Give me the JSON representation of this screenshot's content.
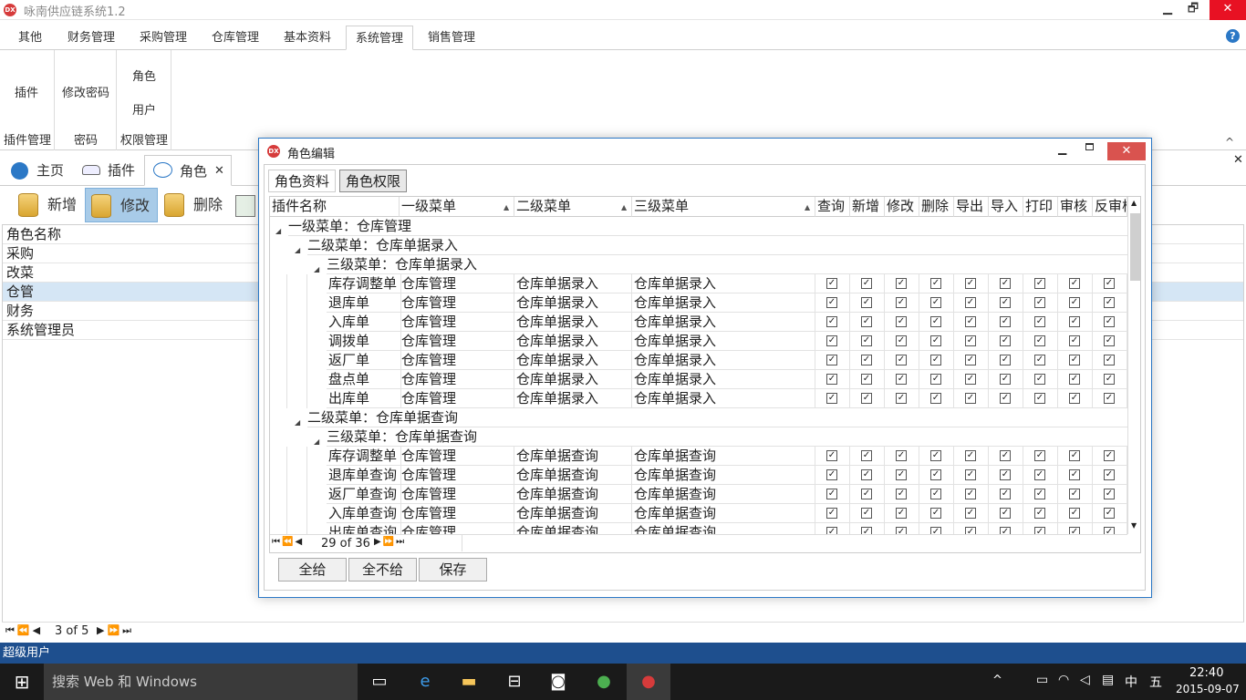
{
  "app": {
    "title": "咏南供应链系统1.2",
    "logo_text": "DX",
    "min": "▁",
    "restore": "🗗",
    "close": "✕"
  },
  "ribbon": {
    "tabs": [
      "其他",
      "财务管理",
      "采购管理",
      "仓库管理",
      "基本资料",
      "系统管理",
      "销售管理"
    ],
    "active_tab": "系统管理",
    "groups": [
      {
        "buttons": [
          "插件"
        ],
        "label": "插件管理"
      },
      {
        "buttons": [
          "修改密码"
        ],
        "label": "密码"
      },
      {
        "buttons": [
          "角色",
          "用户"
        ],
        "label": "权限管理"
      }
    ],
    "help_icon": "?",
    "collapse_icon": "^"
  },
  "doctabs": {
    "home": "主页",
    "plugin": "插件",
    "role": "角色",
    "close": "✕"
  },
  "toolbar": {
    "add": "新增",
    "edit": "修改",
    "delete": "删除"
  },
  "rolelist": {
    "header": "角色名称",
    "rows": [
      "采购",
      "改菜",
      "仓管",
      "财务",
      "系统管理员"
    ],
    "selected": "仓管",
    "pager": "3 of 5"
  },
  "status": {
    "user": "超级用户"
  },
  "taskbar": {
    "search_placeholder": "搜索 Web 和 Windows",
    "time": "22:40",
    "date": "2015-09-07",
    "ime": "中",
    "ime2": "五"
  },
  "dialog": {
    "title": "角色编辑",
    "tabs": [
      "角色资料",
      "角色权限"
    ],
    "active_tab": "角色权限",
    "columns": [
      "插件名称",
      "一级菜单",
      "二级菜单",
      "三级菜单",
      "查询",
      "新增",
      "修改",
      "删除",
      "导出",
      "导入",
      "打印",
      "审核",
      "反审核"
    ],
    "groups": [
      {
        "label": "一级菜单：仓库管理",
        "level": 1,
        "expand": "◢"
      },
      {
        "label": "二级菜单：仓库单据录入",
        "level": 2,
        "expand": "◢"
      },
      {
        "label": "三级菜单：仓库单据录入",
        "level": 3,
        "expand": "◢"
      }
    ],
    "rows_a": [
      [
        "库存调整单",
        "仓库管理",
        "仓库单据录入",
        "仓库单据录入"
      ],
      [
        "退库单",
        "仓库管理",
        "仓库单据录入",
        "仓库单据录入"
      ],
      [
        "入库单",
        "仓库管理",
        "仓库单据录入",
        "仓库单据录入"
      ],
      [
        "调拨单",
        "仓库管理",
        "仓库单据录入",
        "仓库单据录入"
      ],
      [
        "返厂单",
        "仓库管理",
        "仓库单据录入",
        "仓库单据录入"
      ],
      [
        "盘点单",
        "仓库管理",
        "仓库单据录入",
        "仓库单据录入"
      ],
      [
        "出库单",
        "仓库管理",
        "仓库单据录入",
        "仓库单据录入"
      ]
    ],
    "group2": {
      "label": "二级菜单：仓库单据查询",
      "expand": "◢"
    },
    "group3": {
      "label": "三级菜单：仓库单据查询",
      "expand": "◢"
    },
    "rows_b": [
      [
        "库存调整单",
        "仓库管理",
        "仓库单据查询",
        "仓库单据查询"
      ],
      [
        "退库单查询",
        "仓库管理",
        "仓库单据查询",
        "仓库单据查询"
      ],
      [
        "返厂单查询",
        "仓库管理",
        "仓库单据查询",
        "仓库单据查询"
      ],
      [
        "入库单查询",
        "仓库管理",
        "仓库单据查询",
        "仓库单据查询"
      ],
      [
        "出库单查询",
        "仓库管理",
        "仓库单据查询",
        "仓库单据查询"
      ]
    ],
    "pager": "29 of 36",
    "buttons": {
      "all": "全给",
      "none": "全不给",
      "save": "保存"
    },
    "check_glyph": "✓"
  }
}
